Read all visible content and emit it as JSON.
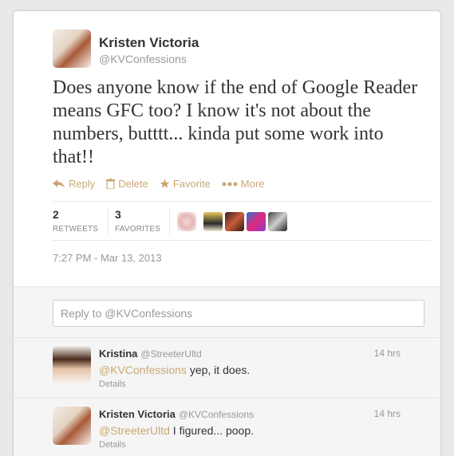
{
  "tweet": {
    "fullname": "Kristen Victoria",
    "username": "@KVConfessions",
    "text": "Does anyone know if the end of Google Reader means GFC too? I know it's not about the numbers, butttt... kinda put some work into that!!",
    "actions": {
      "reply": "Reply",
      "delete": "Delete",
      "favorite": "Favorite",
      "more": "More"
    },
    "stats": {
      "retweets_count": "2",
      "retweets_label": "RETWEETS",
      "favorites_count": "3",
      "favorites_label": "FAVORITES"
    },
    "timestamp": "7:27 PM - Mar 13, 2013"
  },
  "reply_box": {
    "placeholder": "Reply to @KVConfessions"
  },
  "replies": [
    {
      "fullname": "Kristina",
      "username": "@StreeterUltd",
      "time": "14 hrs",
      "mention": "@KVConfessions",
      "text": " yep, it does.",
      "details": "Details"
    },
    {
      "fullname": "Kristen Victoria",
      "username": "@KVConfessions",
      "time": "14 hrs",
      "mention": "@StreeterUltd",
      "text": " I figured... poop.",
      "details": "Details"
    }
  ],
  "colors": {
    "accent": "#c9a874",
    "muted": "#999999",
    "text": "#333333"
  }
}
